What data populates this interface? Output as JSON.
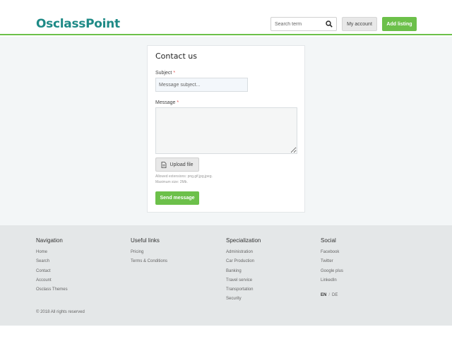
{
  "header": {
    "logo_text": "OsclassPoint",
    "search_placeholder": "Search term",
    "my_account_label": "My account",
    "add_listing_label": "Add listing"
  },
  "contact": {
    "title": "Contact us",
    "subject_label": "Subject",
    "subject_placeholder": "Message subject...",
    "message_label": "Message",
    "required_mark": "*",
    "upload_label": "Upload file",
    "allowed_extensions": "Allowed extensions: png,gif,jpg,jpeg.",
    "max_size": "Maximum size: 2Mb.",
    "send_label": "Send message"
  },
  "footer": {
    "columns": [
      {
        "title": "Navigation",
        "links": [
          "Home",
          "Search",
          "Contact",
          "Account",
          "Osclass Themes"
        ]
      },
      {
        "title": "Useful links",
        "links": [
          "Pricing",
          "Terms & Conditions"
        ]
      },
      {
        "title": "Specialization",
        "links": [
          "Administration",
          "Car Production",
          "Banking",
          "Travel service",
          "Transportation",
          "Security"
        ]
      },
      {
        "title": "Social",
        "links": [
          "Facebook",
          "Twitter",
          "Google plus",
          "LinkedIn"
        ]
      }
    ],
    "languages": {
      "active": "EN",
      "separator": "/",
      "other": "DE"
    },
    "copyright": "© 2018 All rights reserved"
  },
  "colors": {
    "accent": "#6cc04a",
    "logo": "#1e8a86"
  },
  "icons": {
    "search": "search-icon",
    "upload": "file-icon",
    "logo_pin": "map-pin-icon"
  }
}
